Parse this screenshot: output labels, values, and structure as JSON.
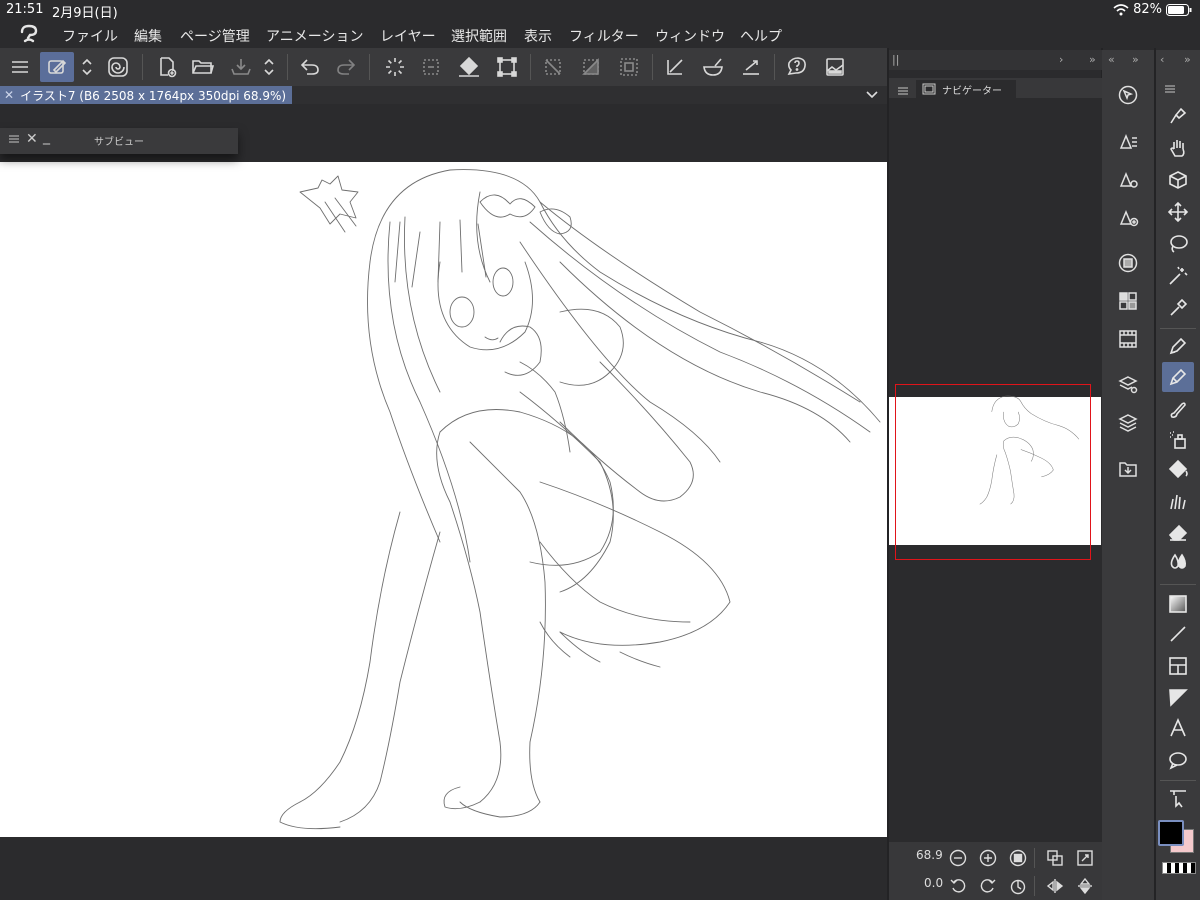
{
  "status_bar": {
    "time": "21:51",
    "date": "2月9日(日)",
    "battery": "82%"
  },
  "menu": [
    "ファイル",
    "編集",
    "ページ管理",
    "アニメーション",
    "レイヤー",
    "選択範囲",
    "表示",
    "フィルター",
    "ウィンドウ",
    "ヘルプ"
  ],
  "document_tab": {
    "title": "イラスト7 (B6 2508 x 1764px 350dpi 68.9%)"
  },
  "sub_view": {
    "title": "サブビュー"
  },
  "navigator": {
    "title": "ナビゲーター",
    "zoom": "68.9",
    "rotation": "0.0"
  },
  "colors": {
    "accent": "#5c6f98",
    "panel": "#3a3a3c",
    "background": "#2b2b2d",
    "nav_frame": "#e0141a",
    "main_color": "#000000",
    "sub_color": "#f4c9cc"
  }
}
